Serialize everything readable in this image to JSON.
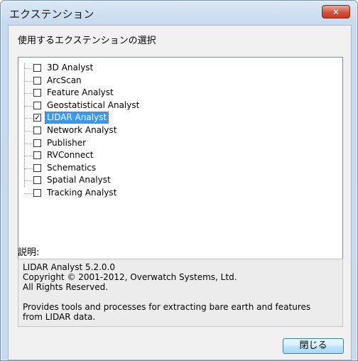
{
  "window": {
    "title": "エクステンション",
    "close_symbol": "✕"
  },
  "extensions_section": {
    "label": "使用するエクステンションの選択",
    "items": [
      {
        "label": "3D Analyst",
        "checked": false
      },
      {
        "label": "ArcScan",
        "checked": false
      },
      {
        "label": "Feature Analyst",
        "checked": false
      },
      {
        "label": "Geostatistical Analyst",
        "checked": false
      },
      {
        "label": "LIDAR Analyst",
        "checked": true,
        "selected": true
      },
      {
        "label": "Network Analyst",
        "checked": false
      },
      {
        "label": "Publisher",
        "checked": false
      },
      {
        "label": "RVConnect",
        "checked": false
      },
      {
        "label": "Schematics",
        "checked": false
      },
      {
        "label": "Spatial Analyst",
        "checked": false
      },
      {
        "label": "Tracking Analyst",
        "checked": false
      }
    ]
  },
  "description": {
    "label": "説明:",
    "line1": "LIDAR Analyst 5.2.0.0",
    "line2": "Copyright © 2001-2012, Overwatch Systems, Ltd.",
    "line3": "All Rights Reserved.",
    "line4": "Provides tools and processes for extracting bare earth and features",
    "line5": "from LIDAR data."
  },
  "buttons": {
    "close_label": "閉じる"
  },
  "check_mark": "✓"
}
